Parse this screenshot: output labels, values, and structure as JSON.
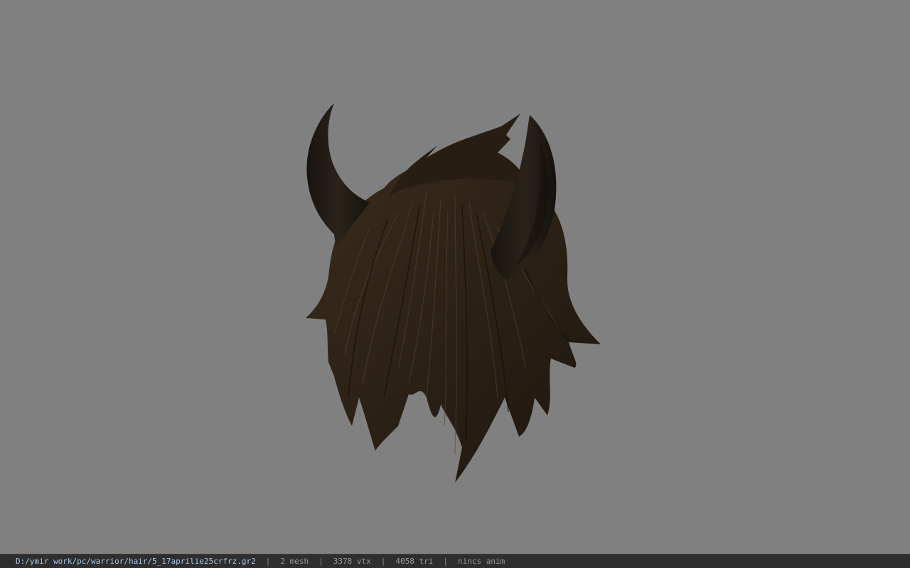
{
  "viewport": {
    "background_color": "#808080",
    "model": {
      "hair_color": "#2c2116",
      "hair_highlight": "#5a4430",
      "horn_color": "#1f1a15"
    }
  },
  "status_bar": {
    "file_path": "D:/ymir work/pc/warrior/hair/5_17aprilie25crfrz.gr2",
    "separator": "|",
    "mesh_count": "2 mesh",
    "vertex_count": "3378 vtx",
    "triangle_count": "4058 tri",
    "animation": "nincs anim",
    "path_color": "#a9c7e6",
    "text_color": "#9a9a9a"
  }
}
